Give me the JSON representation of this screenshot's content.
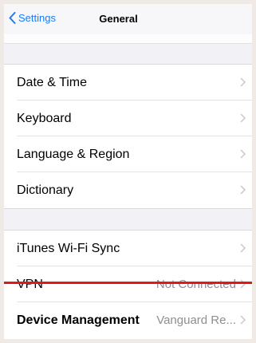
{
  "navbar": {
    "back_label": "Settings",
    "title": "General"
  },
  "group1": [
    {
      "label": "Date & Time",
      "value": ""
    },
    {
      "label": "Keyboard",
      "value": ""
    },
    {
      "label": "Language & Region",
      "value": ""
    },
    {
      "label": "Dictionary",
      "value": ""
    }
  ],
  "group2": [
    {
      "label": "iTunes Wi-Fi Sync",
      "value": ""
    },
    {
      "label": "VPN",
      "value": "Not Connected"
    },
    {
      "label": "Device Management",
      "value": "Vanguard Re..."
    }
  ],
  "colors": {
    "accent": "#1a7cf6",
    "annotation_line": "#e01818"
  }
}
